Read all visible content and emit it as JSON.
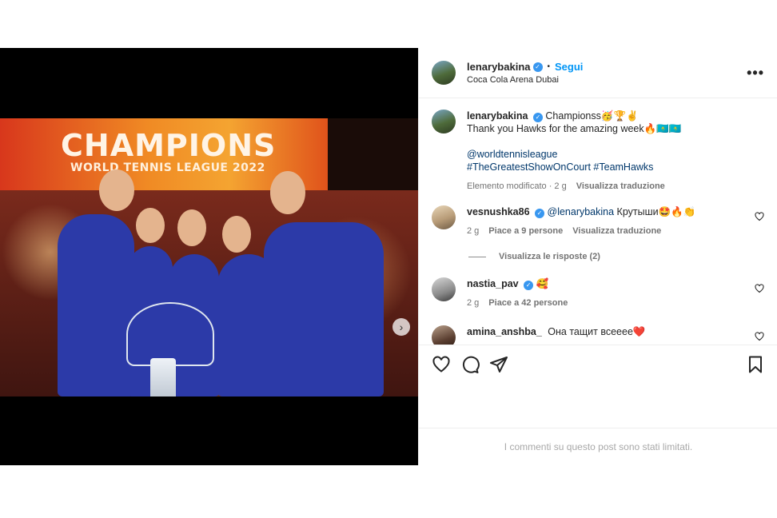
{
  "post": {
    "author": "lenarybakina",
    "follow_label": "Segui",
    "separator": "•",
    "location": "Coca Cola Arena Dubai",
    "more_label": "•••"
  },
  "media": {
    "banner_title": "CHAMPIONS",
    "banner_subtitle": "WORLD TENNIS LEAGUE 2022",
    "next_label": "›",
    "carousel_count": 3,
    "carousel_active": 0
  },
  "caption": {
    "username": "lenarybakina",
    "line1": "Championss🥳🏆✌️",
    "line2": "Thank you Hawks for the amazing week🔥🇰🇿🇰🇿",
    "mention": "@worldtennisleague",
    "hashtags": "#TheGreatestShowOnCourt #TeamHawks",
    "edited": "Elemento modificato · 2 g",
    "translate": "Visualizza traduzione"
  },
  "comments": [
    {
      "username": "vesnushka86",
      "mention": "@lenarybakina",
      "text": " Крутыши🤩🔥👏",
      "time": "2 g",
      "likes": "Piace a 9 persone",
      "translate": "Visualizza traduzione",
      "replies": "Visualizza le risposte (2)"
    },
    {
      "username": "nastia_pav",
      "text": "🥰",
      "time": "2 g",
      "likes": "Piace a 42 persone"
    },
    {
      "username": "amina_anshba_",
      "text": "Она тащит всееее❤️"
    }
  ],
  "footer": {
    "limited_notice": "I commenti su questo post sono stati limitati."
  },
  "colors": {
    "accent": "#0095f6",
    "verified": "#3897f0",
    "link": "#00376b",
    "muted": "#737373"
  }
}
